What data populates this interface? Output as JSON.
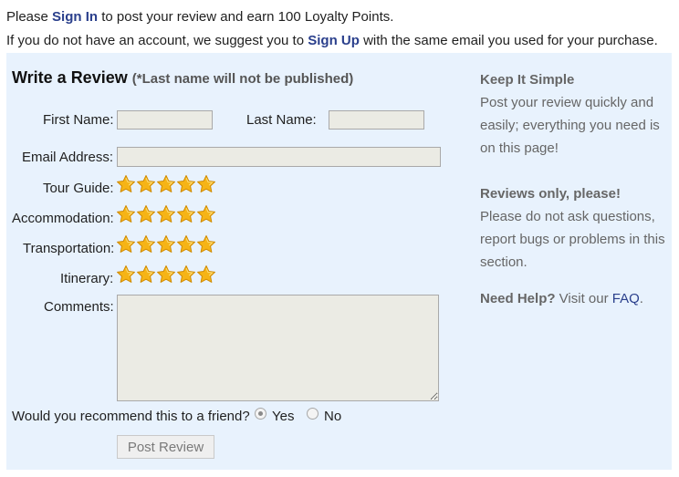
{
  "header": {
    "line1_pre": "Please ",
    "sign_in": "Sign In",
    "line1_post": " to post your review and earn 100 Loyalty Points.",
    "line2_pre": "If you do not have an account, we suggest you to ",
    "sign_up": "Sign Up",
    "line2_post": " with the same email you used for your purchase."
  },
  "form": {
    "title": "Write a Review",
    "note": "(*Last name will not be published)",
    "first_name_label": "First Name:",
    "last_name_label": "Last Name:",
    "email_label": "Email Address:",
    "first_name_value": "",
    "last_name_value": "",
    "email_value": "",
    "ratings": [
      {
        "label": "Tour Guide:",
        "stars": 5
      },
      {
        "label": "Accommodation:",
        "stars": 5
      },
      {
        "label": "Transportation:",
        "stars": 5
      },
      {
        "label": "Itinerary:",
        "stars": 5
      }
    ],
    "comments_label": "Comments:",
    "comments_value": "",
    "recommend_label": "Would you recommend this to a friend?",
    "recommend_yes": "Yes",
    "recommend_no": "No",
    "recommend_selected": "Yes",
    "submit_label": "Post Review"
  },
  "sidebar": {
    "simple_heading": "Keep It Simple",
    "simple_text": "Post your review quickly and easily; everything you need is on this page!",
    "reviews_heading": "Reviews only, please!",
    "reviews_text": "Please do not ask questions, report bugs or problems in this section.",
    "help_heading": "Need Help?",
    "help_text": " Visit our ",
    "help_link": "FAQ",
    "help_end": "."
  },
  "colors": {
    "link": "#2a3f8c",
    "panel_bg": "#e8f2fd",
    "star_fill": "#f6b416"
  }
}
